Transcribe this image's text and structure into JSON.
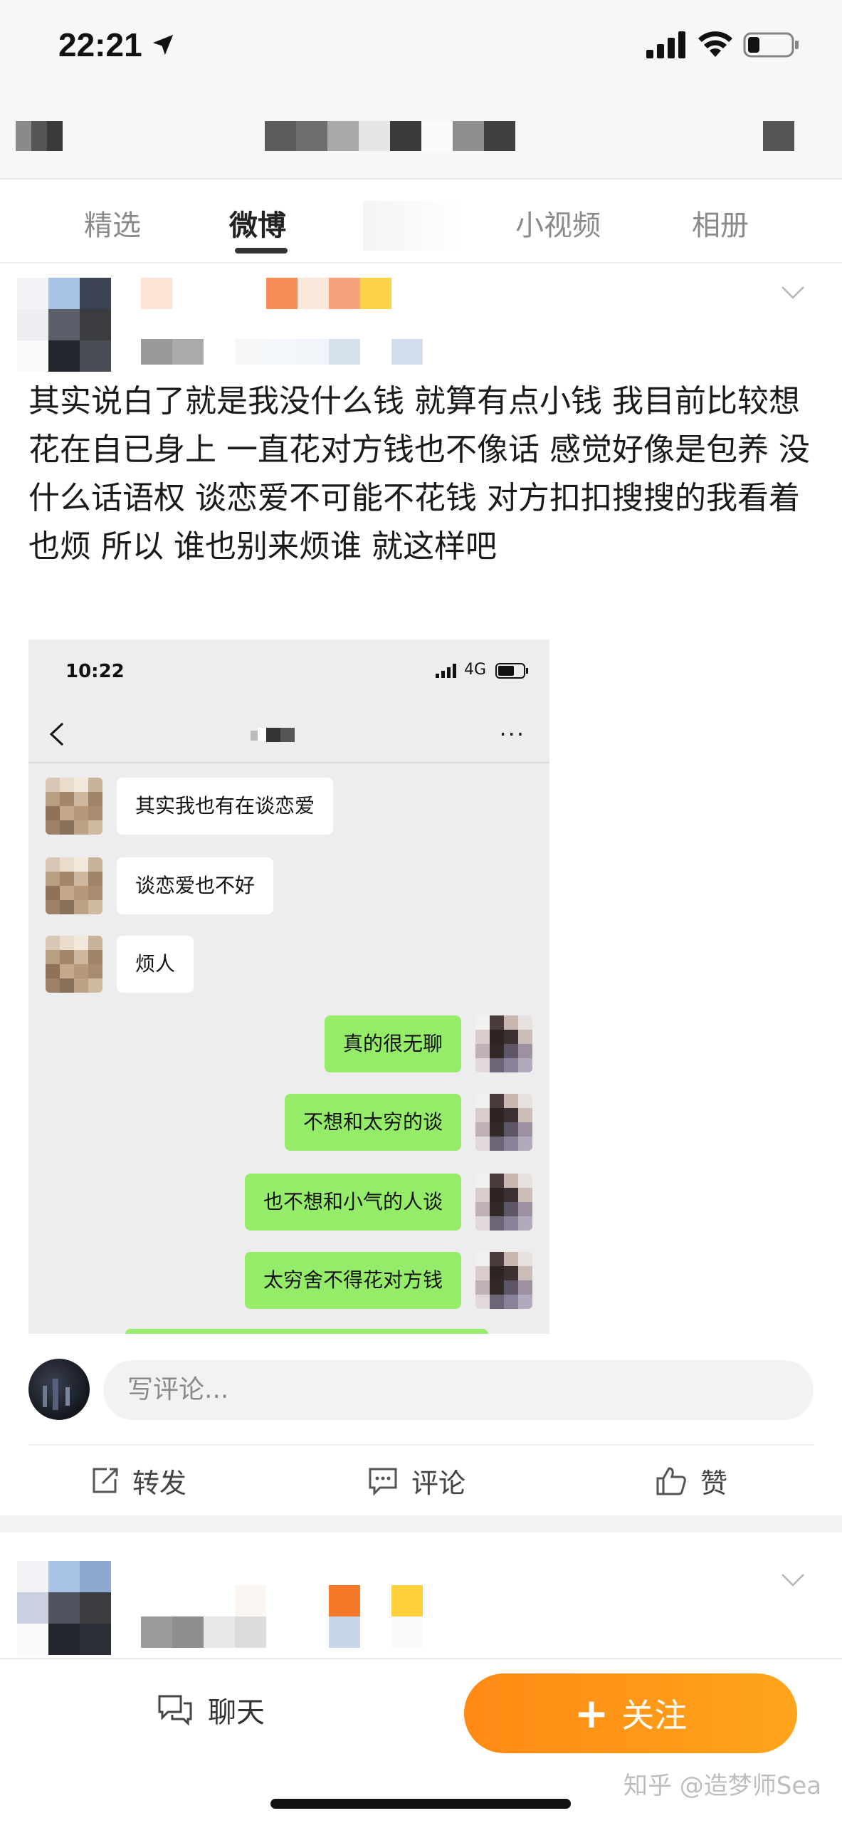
{
  "status_bar": {
    "time": "22:21"
  },
  "tabs": [
    {
      "label": "精选",
      "active": false
    },
    {
      "label": "微博",
      "active": true
    },
    {
      "label": "",
      "active": false
    },
    {
      "label": "小视频",
      "active": false
    },
    {
      "label": "相册",
      "active": false
    }
  ],
  "post": {
    "text": "其实说白了就是我没什么钱 就算有点小钱 我目前比较想花在自已身上  一直花对方钱也不像话 感觉好像是包养 没什么话语权  谈恋爱不可能不花钱 对方扣扣搜搜的我看着也烦 所以 谁也别来烦谁 就这样吧"
  },
  "chat_screenshot": {
    "time": "10:22",
    "network": "4G",
    "more": "···",
    "messages": [
      {
        "side": "in",
        "text": "其实我也有在谈恋爱"
      },
      {
        "side": "in",
        "text": "谈恋爱也不好"
      },
      {
        "side": "in",
        "text": "烦人"
      },
      {
        "side": "out",
        "text": "真的很无聊"
      },
      {
        "side": "out",
        "text": "不想和太穷的谈"
      },
      {
        "side": "out",
        "text": "也不想和小气的人谈"
      },
      {
        "side": "out",
        "text": "太穷舍不得花对方钱"
      }
    ]
  },
  "comment": {
    "placeholder": "写评论..."
  },
  "actions": {
    "repost": "转发",
    "comment": "评论",
    "like": "赞"
  },
  "bottom_bar": {
    "chat": "聊天",
    "follow_plus": "+",
    "follow": "关注",
    "watermark": "知乎 @造梦师Sea"
  },
  "colors": {
    "accent_orange": "#ff9a1a",
    "bubble_green": "#95ec69",
    "background_gray": "#f7f7f7"
  }
}
